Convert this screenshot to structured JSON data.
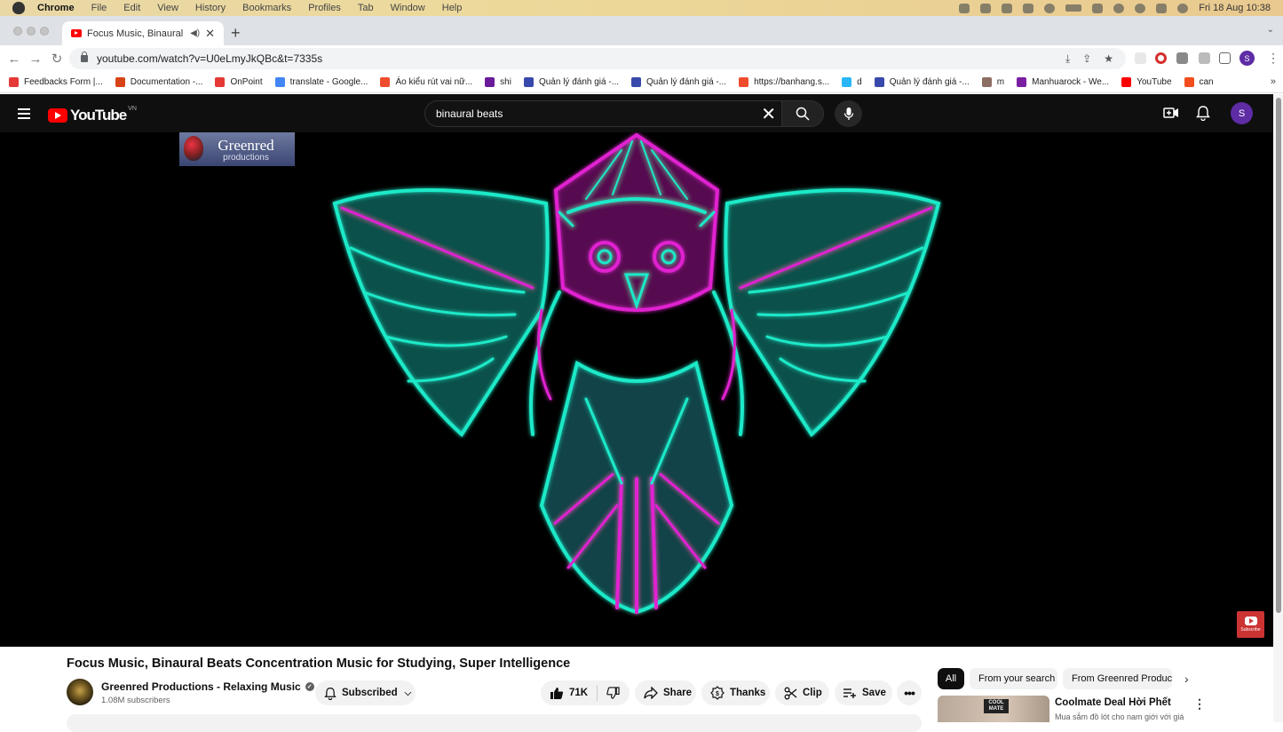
{
  "macos_menu": {
    "app_name": "Chrome",
    "items": [
      "File",
      "Edit",
      "View",
      "History",
      "Bookmarks",
      "Profiles",
      "Tab",
      "Window",
      "Help"
    ],
    "clock": "Fri 18 Aug  10:38"
  },
  "browser": {
    "tab_title": "Focus Music, Binaural Beat",
    "url": "youtube.com/watch?v=U0eLmyJkQBc&t=7335s",
    "profile_initial": "S",
    "bookmarks": [
      {
        "label": "Feedbacks Form |...",
        "color": "#e53935"
      },
      {
        "label": "Documentation -...",
        "color": "#d84315"
      },
      {
        "label": "OnPoint",
        "color": "#e53935"
      },
      {
        "label": "translate - Google...",
        "color": "#4285f4"
      },
      {
        "label": "Áo kiểu rút vai nữ...",
        "color": "#ee4d2d"
      },
      {
        "label": "shi",
        "color": "#6a1b9a"
      },
      {
        "label": "Quản lý đánh giá -...",
        "color": "#3949ab"
      },
      {
        "label": "Quản lý đánh giá -...",
        "color": "#3949ab"
      },
      {
        "label": "https://banhang.s...",
        "color": "#ee4d2d"
      },
      {
        "label": "d",
        "color": "#29b6f6"
      },
      {
        "label": "Quản lý đánh giá -...",
        "color": "#3949ab"
      },
      {
        "label": "m",
        "color": "#8d6e63"
      },
      {
        "label": "Manhuarock - We...",
        "color": "#7b1fa2"
      },
      {
        "label": "YouTube",
        "color": "#ff0000"
      },
      {
        "label": "can",
        "color": "#f24e1e"
      }
    ]
  },
  "youtube": {
    "logo_text": "YouTube",
    "country_code": "VN",
    "search_value": "binaural beats",
    "avatar_initial": "S",
    "watermark": {
      "line1": "Greenred",
      "line2": "productions"
    },
    "subscribe_badge": "Subscribe",
    "video": {
      "title": "Focus Music, Binaural Beats Concentration Music for Studying, Super Intelligence",
      "channel": "Greenred Productions - Relaxing Music",
      "subscribers": "1.08M subscribers",
      "subscribe_label": "Subscribed",
      "likes": "71K",
      "share_label": "Share",
      "thanks_label": "Thanks",
      "clip_label": "Clip",
      "save_label": "Save"
    },
    "chips": [
      "All",
      "From your search",
      "From Greenred Productions"
    ],
    "ad": {
      "title": "Coolmate Deal Hời Phết",
      "subtitle": "Mua sắm đồ lót cho nam giới với giá",
      "thumb_logo": "COOL MATE"
    }
  },
  "colors": {
    "owl_cyan": "#1de9c8",
    "owl_magenta": "#e020d0",
    "youtube_red": "#ff0000"
  }
}
